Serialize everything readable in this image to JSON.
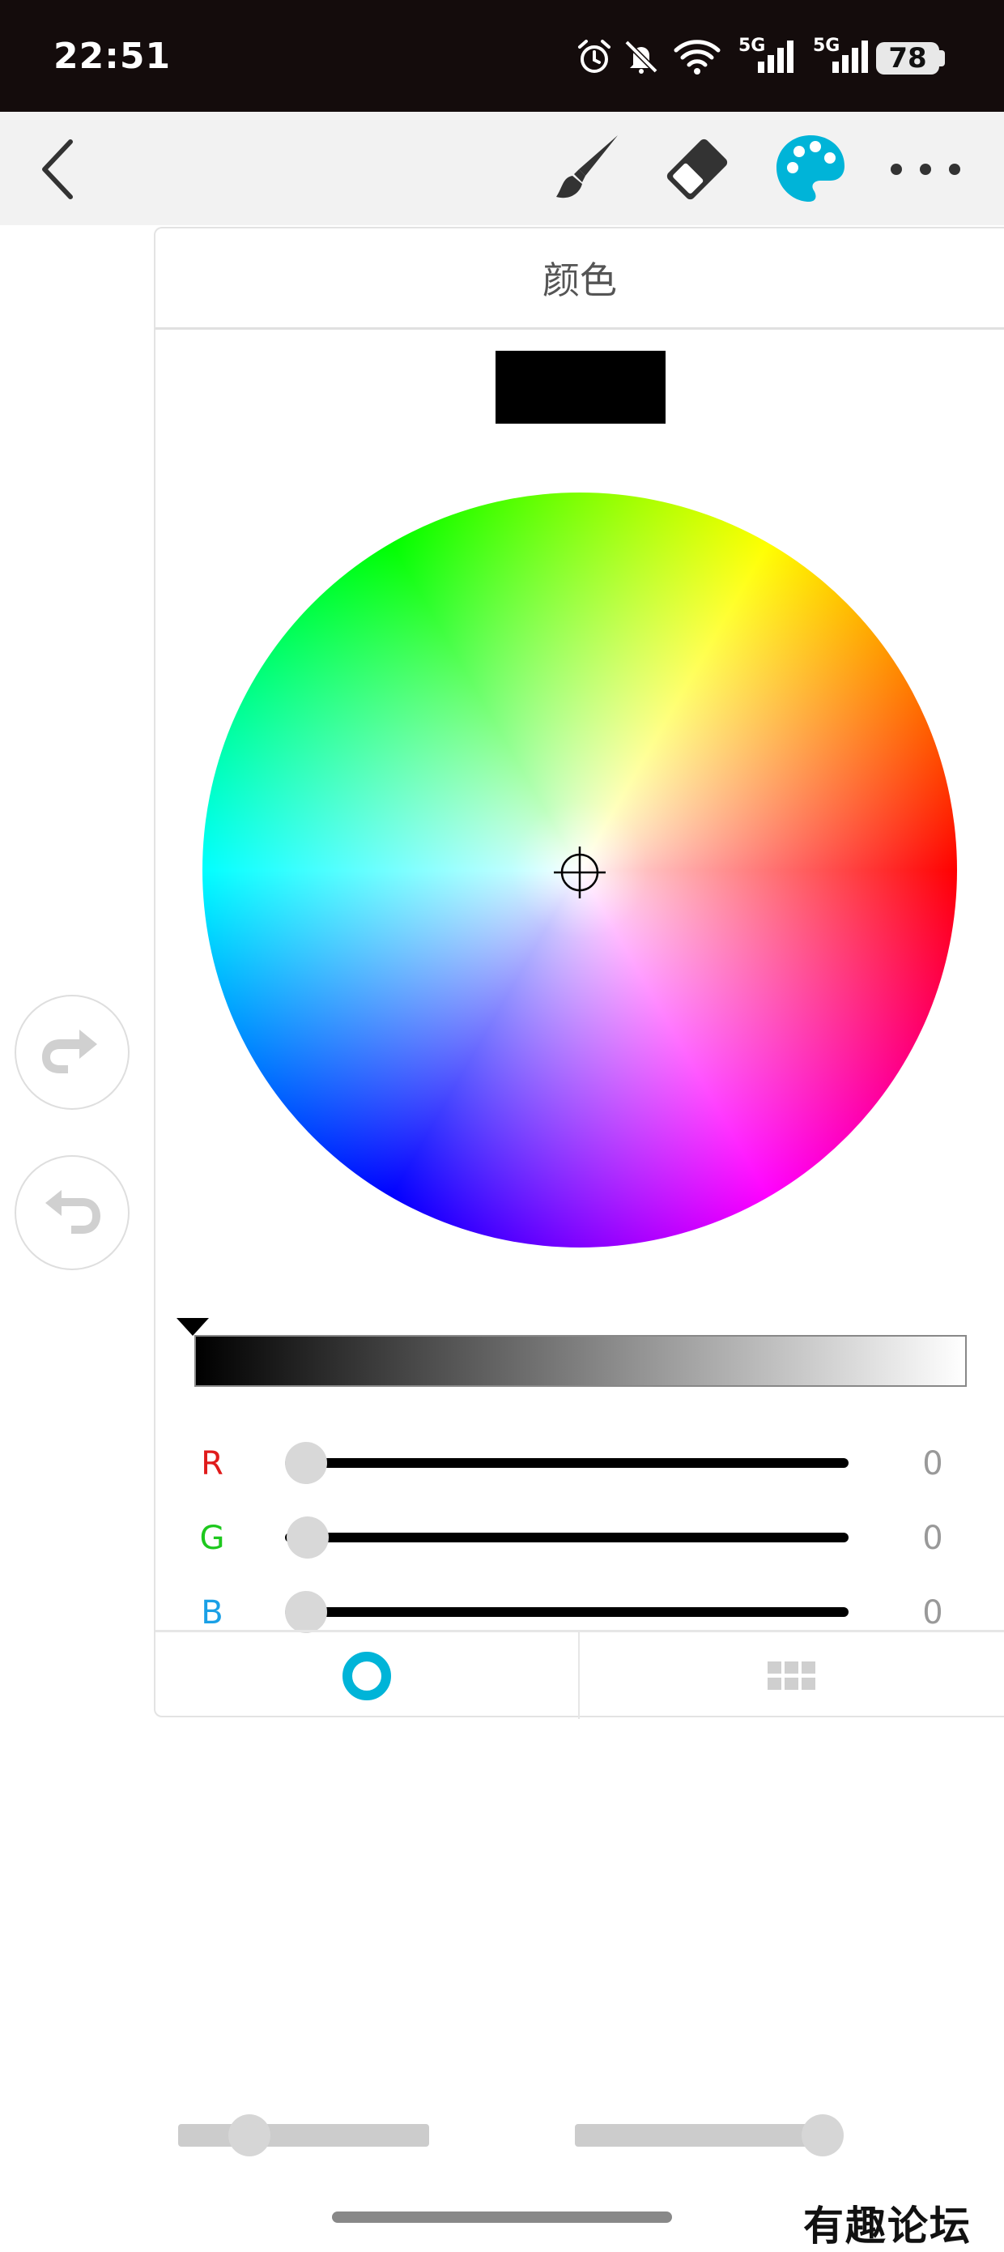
{
  "status_bar": {
    "time": "22:51",
    "net1": "5G",
    "net2": "5G",
    "battery": "78"
  },
  "toolbar": {
    "back_icon": "chevron-left-icon",
    "brush_icon": "brush-icon",
    "eraser_icon": "eraser-icon",
    "palette_icon": "palette-icon",
    "more_icon": "more-icon",
    "active_color": "#00b4d8"
  },
  "panel": {
    "title": "颜色",
    "preview_color": "#000000",
    "brightness_level": 0,
    "rgb": [
      {
        "label": "R",
        "value": "0",
        "color": "#e01b1b"
      },
      {
        "label": "G",
        "value": "0",
        "color": "#1ec81e"
      },
      {
        "label": "B",
        "value": "0",
        "color": "#1aa0e6"
      }
    ],
    "tabs": [
      {
        "icon": "color-wheel-tab-icon",
        "active": true
      },
      {
        "icon": "swatch-grid-tab-icon",
        "active": false
      }
    ]
  },
  "side": {
    "redo_icon": "redo-icon",
    "undo_icon": "undo-icon"
  },
  "bottom": {
    "slider_left_level": 0.28,
    "slider_right_level": 0.98
  },
  "watermark": "有趣论坛"
}
